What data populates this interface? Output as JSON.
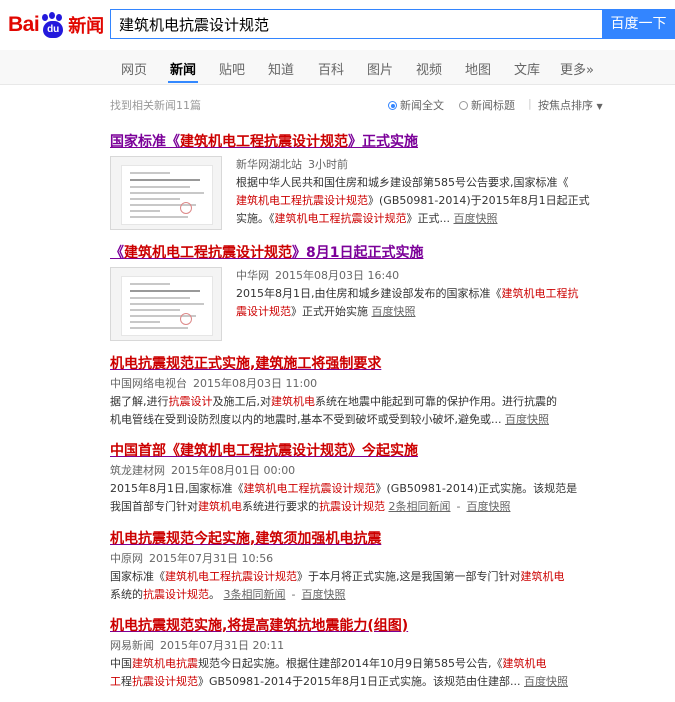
{
  "header": {
    "logo_text_bai": "Bai",
    "logo_text_du": "du",
    "logo_text_news": "新闻",
    "search_value": "建筑机电抗震设计规范",
    "search_button": "百度一下"
  },
  "nav": {
    "tabs": [
      "网页",
      "新闻",
      "贴吧",
      "知道",
      "百科",
      "图片",
      "视频",
      "地图",
      "文库",
      "更多»"
    ]
  },
  "toolbar": {
    "result_count": "找到相关新闻11篇",
    "opt_fulltext": "新闻全文",
    "opt_title": "新闻标题",
    "opt_sort": "按焦点排序"
  },
  "results": [
    {
      "title_parts": [
        "国家标准《",
        "建筑机电工程抗震设计规范",
        "》正式实施"
      ],
      "source": "新华网湖北站",
      "time": "3小时前",
      "line1": "根据中华人民共和国住房和城乡建设部第585号公告要求,国家标准《",
      "line2_em": "建筑机电工程抗震设计规范",
      "line2_rest": "》(GB50981-2014)于2015年8月1日起正式",
      "line3_a": "实施。《",
      "line3_em": "建筑机电工程抗震设计规范",
      "line3_b": "》正式...",
      "cache": "百度快照"
    },
    {
      "title_parts": [
        "《",
        "建筑机电工程抗震设计规范",
        "》8月1日起正式实施"
      ],
      "source": "中华网",
      "time": "2015年08月03日 16:40",
      "line1_a": "2015年8月1日,由住房和城乡建设部发布的国家标准《",
      "line1_em": "建筑机电工程抗",
      "line2_em": "震设计规范",
      "line2_rest": "》正式开始实施",
      "cache": "百度快照"
    },
    {
      "title": "机电抗震规范正式实施,建筑施工将强制要求",
      "source": "中国网络电视台",
      "time": "2015年08月03日 11:00",
      "line1_a": "据了解,进行",
      "line1_em1": "抗震设计",
      "line1_b": "及施工后,对",
      "line1_em2": "建筑机电",
      "line1_c": "系统在地震中能起到可靠的保护作用。进行抗震的",
      "line2": "机电管线在受到设防烈度以内的地震时,基本不受到破坏或受到较小破坏,避免或...",
      "cache": "百度快照"
    },
    {
      "title_parts": [
        "中国首部《",
        "建筑机电工程抗震设计规范",
        "》今起实施"
      ],
      "source": "筑龙建材网",
      "time": "2015年08月01日 00:00",
      "line1_a": "2015年8月1日,国家标准《",
      "line1_em": "建筑机电工程抗震设计规范",
      "line1_b": "》(GB50981-2014)正式实施。该规范是",
      "line2_a": "我国首部专门针对",
      "line2_em1": "建筑机电",
      "line2_b": "系统进行要求的",
      "line2_em2": "抗震设计规范",
      "related": "2条相同新闻",
      "cache": "百度快照"
    },
    {
      "title": "机电抗震规范今起实施,建筑须加强机电抗震",
      "source": "中原网",
      "time": "2015年07月31日 10:56",
      "line1_a": "国家标准《",
      "line1_em": "建筑机电工程抗震设计规范",
      "line1_b": "》于本月将正式实施,这是我国第一部专门针对",
      "line1_em2": "建筑机电",
      "line2_a": "系统的",
      "line2_em": "抗震设计规范",
      "line2_b": "。",
      "related": "3条相同新闻",
      "cache": "百度快照"
    },
    {
      "title": "机电抗震规范实施,将提高建筑抗地震能力(组图)",
      "source": "网易新闻",
      "time": "2015年07月31日 20:11",
      "line1_a": "中国",
      "line1_em": "建筑机电抗震",
      "line1_b": "规范今日起实施。根据住建部2014年10月9日第585号公告,《",
      "line1_em2": "建筑机电",
      "line2_em0": "工",
      "line2_a": "程",
      "line2_em": "抗震设计规范",
      "line2_b": "》GB50981-2014于2015年8月1日正式实施。该规范由住建部...",
      "cache": "百度快照"
    }
  ]
}
